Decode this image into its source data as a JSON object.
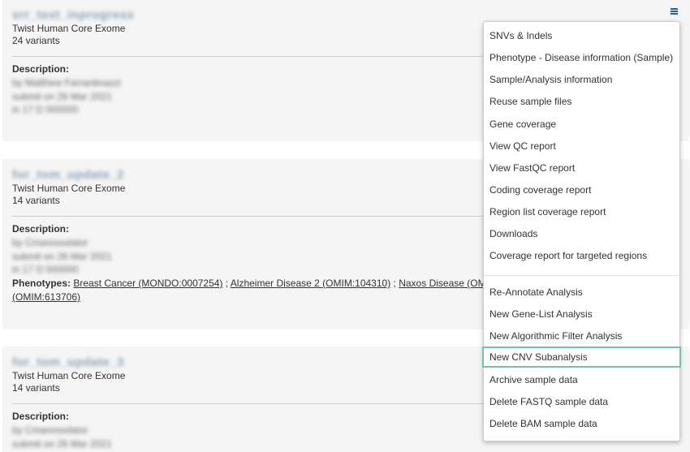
{
  "cards": [
    {
      "title": "srr_test_inprogress",
      "platform": "Twist Human Core Exome",
      "variants": "24 variants",
      "description_label": "Description:",
      "blur_lines": [
        "by Matthew Farrantinazzi",
        "submit on 26 Mar 2021",
        "in 17 D 000000"
      ]
    },
    {
      "title": "for_tom_update_2",
      "platform": "Twist Human Core Exome",
      "variants": "14 variants",
      "description_label": "Description:",
      "blur_lines": [
        "by Cmaressxlator",
        "submit on 26 Mar 2021",
        "in 17 D 000000"
      ],
      "phenotypes_label": "Phenotypes:",
      "phenotypes": [
        "Breast Cancer (MONDO:0007254)",
        "Alzheimer Disease 2 (OMIM:104310)",
        "Naxos Disease (OM",
        "(OMIM:613706)"
      ]
    },
    {
      "title": "for_tom_update_3",
      "platform": "Twist Human Core Exome",
      "variants": "14 variants",
      "description_label": "Description:",
      "blur_lines": [
        "by Cmaressxlator",
        "submit on 26 Mar 2021"
      ]
    }
  ],
  "menu": {
    "items": [
      "SNVs & Indels",
      "Phenotype - Disease information (Sample)",
      "Sample/Analysis information",
      "Reuse sample files",
      "Gene coverage",
      "View QC report",
      "View FastQC report",
      "Coding coverage report",
      "Region list coverage report",
      "Downloads",
      "Coverage report for targeted regions"
    ],
    "actions": [
      "Re-Annotate Analysis",
      "New Gene-List Analysis",
      "New Algorithmic Filter Analysis",
      "New CNV Subanalysis",
      "Archive sample data",
      "Delete FASTQ sample data",
      "Delete BAM sample data"
    ],
    "focused_item": "New CNV Subanalysis"
  },
  "icons": {
    "menu_toggle": "hamburger-icon"
  }
}
